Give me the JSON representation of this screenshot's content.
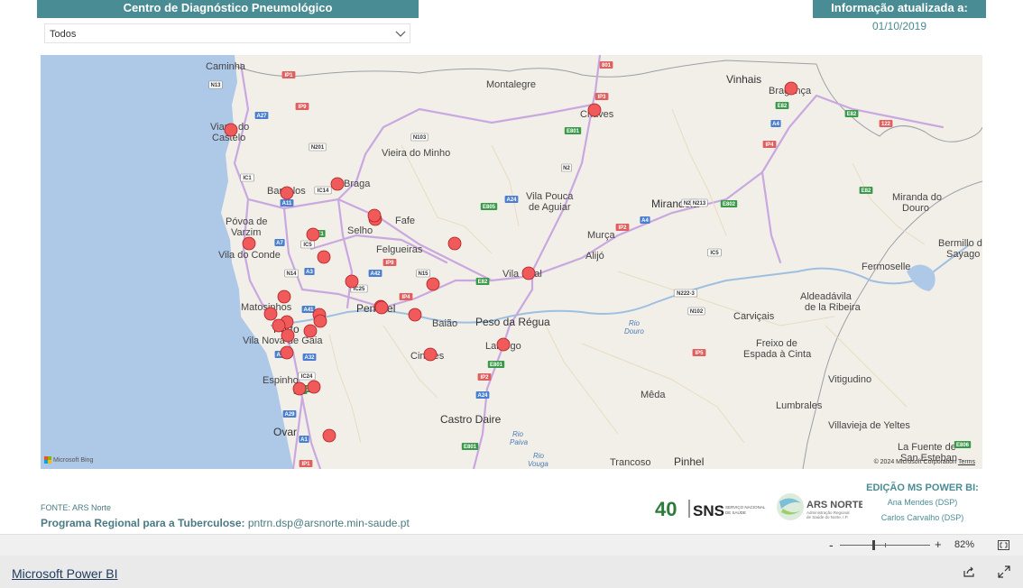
{
  "header": {
    "title": "Centro de Diagnóstico Pneumológico",
    "filter_value": "Todos",
    "info_label": "Informação atualizada a:",
    "info_date": "01/10/2019"
  },
  "map": {
    "places": {
      "caminha": "Caminha",
      "viana1": "Viana do",
      "viana2": "Castelo",
      "montalegre": "Montalegre",
      "chaves": "Chaves",
      "vinhais": "Vinhais",
      "braganca": "Bragança",
      "vieira": "Vieira do Minho",
      "barcelos": "Barcelos",
      "braga": "Braga",
      "povoa1": "Póvoa de",
      "povoa2": "Varzim",
      "viladoconde": "Vila do Conde",
      "fafe": "Fafe",
      "selho": "Selho",
      "felgueiras": "Felgueiras",
      "vilapouca1": "Vila Pouca",
      "vilapouca2": "de Aguiar",
      "mirandela": "Mirandela",
      "miranda1": "Miranda do",
      "miranda2": "Douro",
      "murca": "Murça",
      "vilareal": "Vila Real",
      "alijo": "Alijó",
      "bermillo1": "Bermillo de",
      "bermillo2": "Sayago",
      "fermoselle": "Fermoselle",
      "matosinhos": "Matosinhos",
      "porto": "Porto",
      "vilanovagaia": "Vila Nova de Gaia",
      "penafiel": "Penafiel",
      "baiao": "Baião",
      "pesoregua": "Peso da Régua",
      "lamego": "Lamego",
      "cinfaes": "Cinfães",
      "carvicais": "Carviçais",
      "aldeiadavila1": "Aldeadávila",
      "aldeiadavila2": "de la Ribeira",
      "freixo1": "Freixo de",
      "freixo2": "Espada à Cinta",
      "espinho": "Espinho",
      "ovar": "Ovar",
      "meda": "Mêda",
      "castrodaire": "Castro Daire",
      "vitigudino": "Vitigudino",
      "lumbrales": "Lumbrales",
      "villavieja": "Villavieja de Yeltes",
      "lafuente1": "La Fuente de",
      "lafuente2": "San Esteban",
      "trancoso": "Trancoso",
      "pinhel": "Pinhel",
      "rio_douro1": "Rio",
      "rio_douro2": "Douro",
      "rio_paiva1": "Rio",
      "rio_paiva2": "Paiva",
      "rio_vouga1": "Rio",
      "rio_vouga2": "Vouga"
    },
    "road_shields": [
      "N13",
      "IP1",
      "IP9",
      "A27",
      "N201",
      "N103",
      "IP3",
      "E801",
      "N2",
      "E82",
      "A4",
      "IP4",
      "A24",
      "E805",
      "A11",
      "IC1",
      "IC14",
      "A7",
      "IC5",
      "E1",
      "A3",
      "N14",
      "A42",
      "IC25",
      "IP9",
      "N15",
      "E82",
      "A4",
      "N222",
      "IP2",
      "IC5",
      "N222-3",
      "N102",
      "E802",
      "IP4",
      "A41",
      "A29",
      "A32",
      "IC24",
      "E80",
      "A29",
      "A1",
      "IP1",
      "IP2",
      "E801",
      "A24",
      "E801",
      "IP5",
      "E82",
      "122",
      "E82",
      "E806",
      "N213",
      "801",
      "E1"
    ],
    "markers_count": 31,
    "bing_label": "Microsoft Bing",
    "copyright": "© 2024 Microsoft Corporation",
    "terms": "Terms"
  },
  "footer_info": {
    "fonte": "FONTE: ARS Norte",
    "programa_label": "Programa Regional para a Tuberculose:",
    "programa_email": "pntrn.dsp@arsnorte.min-saude.pt",
    "edicao": "EDIÇÃO MS POWER BI:",
    "author1": "Ana Mendes (DSP)",
    "author2": "Carlos Carvalho (DSP)",
    "logo_sns": "SNS",
    "logo_40": "40",
    "logo_sns_sub1": "SERVIÇO NACIONAL",
    "logo_sns_sub2": "DE SAÚDE",
    "logo_ars": "ARS NORTE",
    "logo_ars_sub1": "Administração Regional",
    "logo_ars_sub2": "de Saúde do Norte, I.P."
  },
  "zoom": {
    "minus": "-",
    "plus": "+",
    "percent": "82%",
    "level": 0.37
  },
  "bottom": {
    "powerbi_link": "Microsoft Power BI"
  },
  "colors": {
    "accent": "#4a8c94",
    "marker": "#f05a5a",
    "marker_stroke": "#b02020",
    "water": "#aec8e8"
  }
}
